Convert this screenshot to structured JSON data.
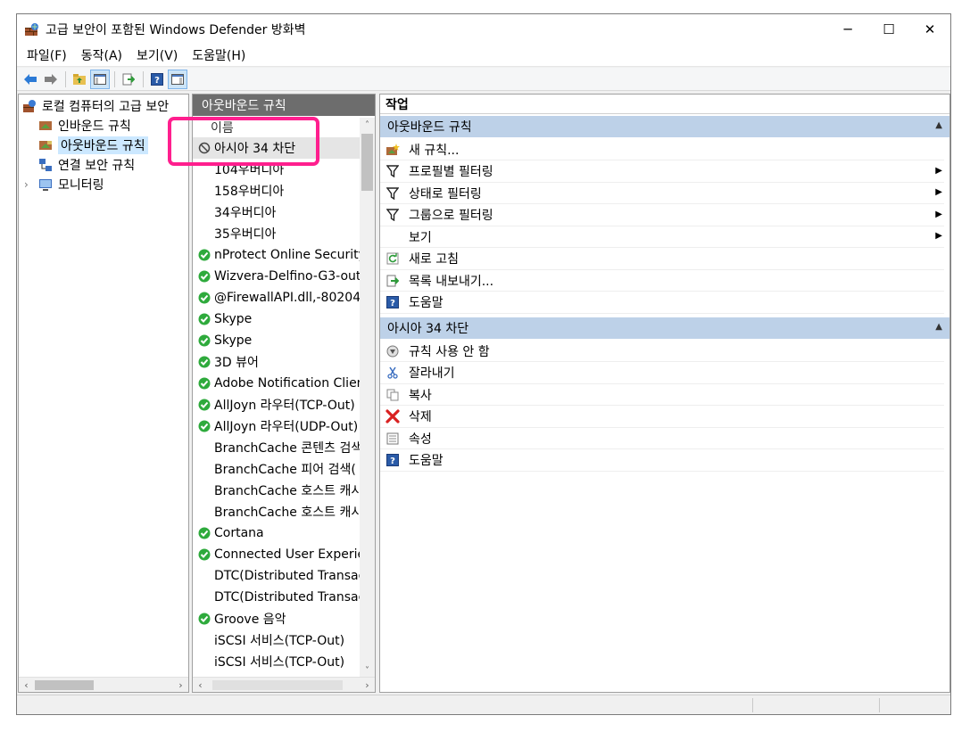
{
  "window": {
    "title": "고급 보안이 포함된 Windows Defender 방화벽",
    "controls": [
      "─",
      "☐",
      "✕"
    ]
  },
  "menu": [
    "파일(F)",
    "동작(A)",
    "보기(V)",
    "도움말(H)"
  ],
  "toolbar_icons": [
    "back-icon",
    "forward-icon",
    "up-folder-icon",
    "show-hide-tree-icon",
    "export-icon",
    "help-icon",
    "show-action-pane-icon"
  ],
  "tree": {
    "root": "로컬 컴퓨터의 고급 보안",
    "items": [
      {
        "label": "인바운드 규칙",
        "icon": "inbound-rules-icon"
      },
      {
        "label": "아웃바운드 규칙",
        "icon": "outbound-rules-icon",
        "selected": true
      },
      {
        "label": "연결 보안 규칙",
        "icon": "connection-security-icon"
      },
      {
        "label": "모니터링",
        "icon": "monitoring-icon",
        "expandable": true
      }
    ]
  },
  "list": {
    "header": "아웃바운드 규칙",
    "column": "이름",
    "rows": [
      {
        "name": "아시아 34 차단",
        "status": "blocked",
        "selected": true
      },
      {
        "name": "104우버디아",
        "status": "none"
      },
      {
        "name": "158우버디아",
        "status": "none"
      },
      {
        "name": "34우버디아",
        "status": "none"
      },
      {
        "name": "35우버디아",
        "status": "none"
      },
      {
        "name": "nProtect Online Security",
        "status": "enabled"
      },
      {
        "name": "Wizvera-Delfino-G3-out",
        "status": "enabled"
      },
      {
        "name": "@FirewallAPI.dll,-80204",
        "status": "enabled"
      },
      {
        "name": "Skype",
        "status": "enabled"
      },
      {
        "name": "Skype",
        "status": "enabled"
      },
      {
        "name": "3D 뷰어",
        "status": "enabled"
      },
      {
        "name": "Adobe Notification Client",
        "status": "enabled"
      },
      {
        "name": "AllJoyn 라우터(TCP-Out)",
        "status": "enabled"
      },
      {
        "name": "AllJoyn 라우터(UDP-Out)",
        "status": "enabled"
      },
      {
        "name": "BranchCache 콘텐츠 검색",
        "status": "none"
      },
      {
        "name": "BranchCache 피어 검색(",
        "status": "none"
      },
      {
        "name": "BranchCache 호스트 캐시",
        "status": "none"
      },
      {
        "name": "BranchCache 호스트 캐시",
        "status": "none"
      },
      {
        "name": "Cortana",
        "status": "enabled"
      },
      {
        "name": "Connected User Experience",
        "status": "enabled"
      },
      {
        "name": "DTC(Distributed Transaction",
        "status": "none"
      },
      {
        "name": "DTC(Distributed Transaction",
        "status": "none"
      },
      {
        "name": "Groove 음악",
        "status": "enabled"
      },
      {
        "name": "iSCSI 서비스(TCP-Out)",
        "status": "none"
      },
      {
        "name": "iSCSI 서비스(TCP-Out)",
        "status": "none"
      }
    ]
  },
  "actions": {
    "title": "작업",
    "sections": [
      {
        "title": "아웃바운드 규칙",
        "items": [
          {
            "label": "새 규칙...",
            "icon": "new-rule-icon"
          },
          {
            "label": "프로필별 필터링",
            "icon": "filter-icon",
            "submenu": true
          },
          {
            "label": "상태로 필터링",
            "icon": "filter-icon",
            "submenu": true
          },
          {
            "label": "그룹으로 필터링",
            "icon": "filter-icon",
            "submenu": true
          },
          {
            "label": "보기",
            "icon": "",
            "submenu": true
          },
          {
            "label": "새로 고침",
            "icon": "refresh-icon"
          },
          {
            "label": "목록 내보내기...",
            "icon": "export-list-icon"
          },
          {
            "label": "도움말",
            "icon": "help-icon"
          }
        ]
      },
      {
        "title": "아시아 34 차단",
        "items": [
          {
            "label": "규칙 사용 안 함",
            "icon": "disable-rule-icon"
          },
          {
            "label": "잘라내기",
            "icon": "cut-icon"
          },
          {
            "label": "복사",
            "icon": "copy-icon"
          },
          {
            "label": "삭제",
            "icon": "delete-icon"
          },
          {
            "label": "속성",
            "icon": "properties-icon"
          },
          {
            "label": "도움말",
            "icon": "help-icon"
          }
        ]
      }
    ]
  },
  "colors": {
    "highlight_box": "#ff1f8e",
    "section_header": "#bdd1e8",
    "list_header": "#6d6d6d",
    "enabled_green": "#2eaa3c",
    "delete_red": "#d92020"
  }
}
